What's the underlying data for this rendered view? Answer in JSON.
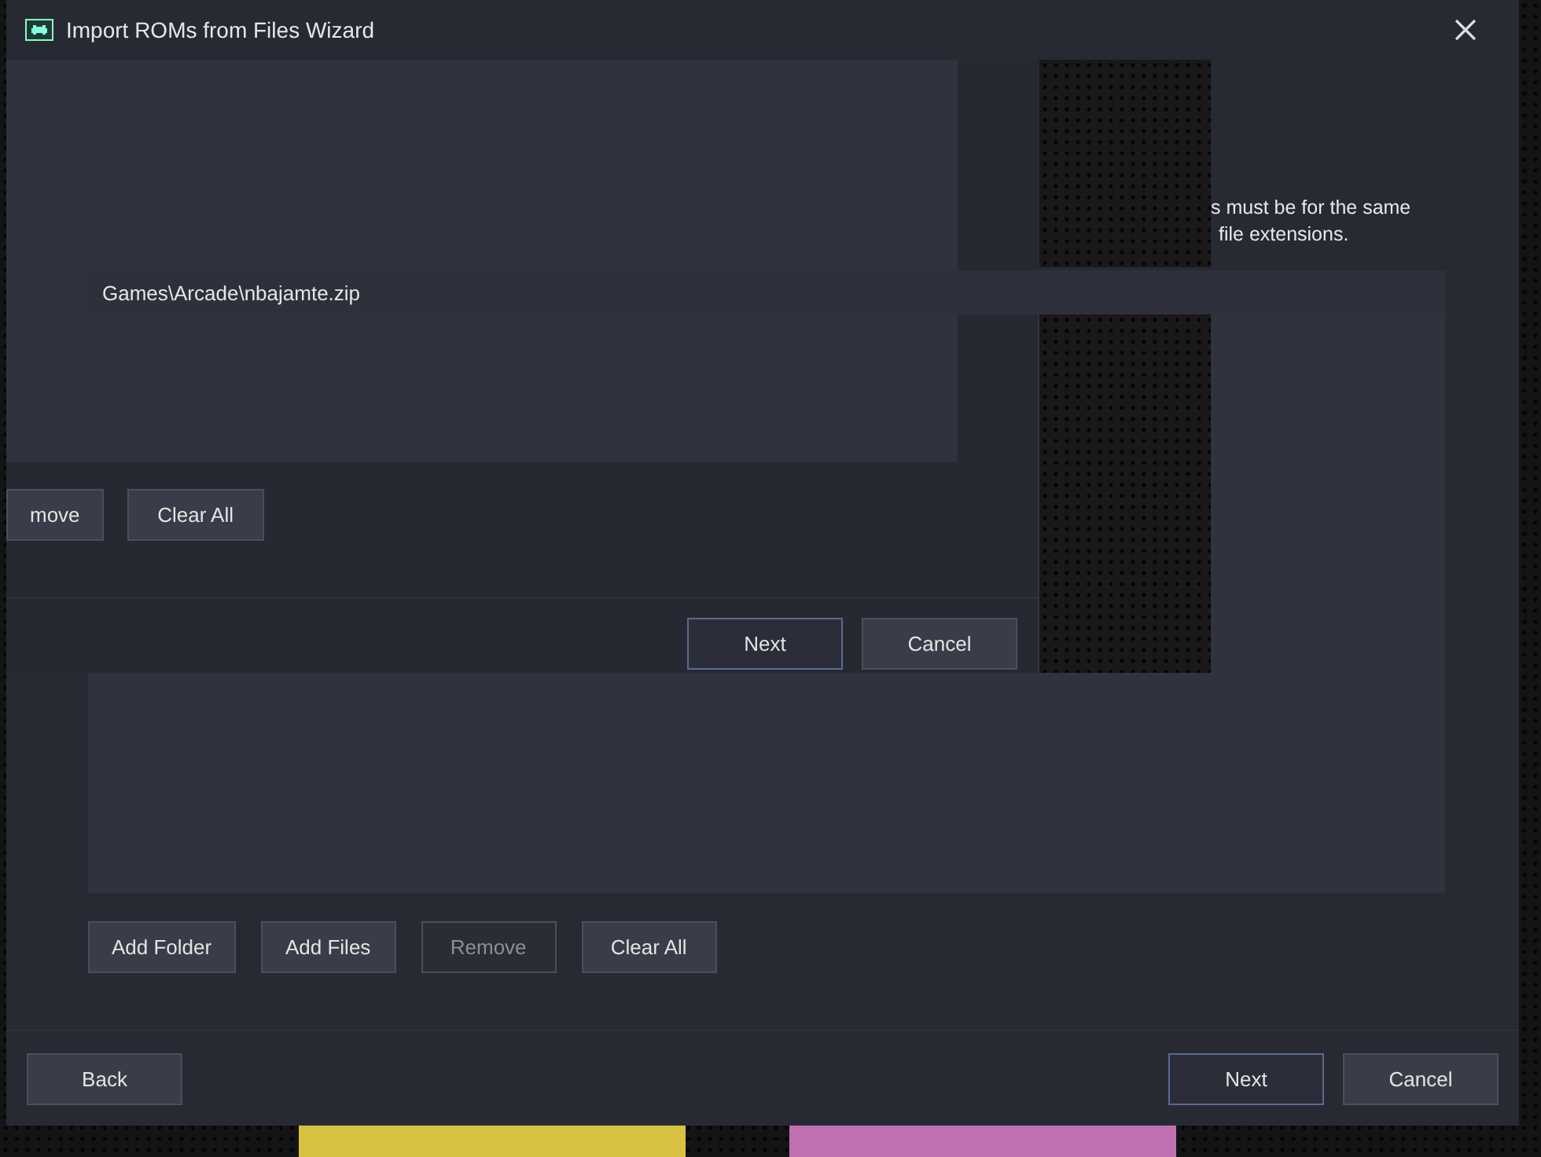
{
  "window": {
    "title": "Import ROMs from Files Wizard"
  },
  "description": [
    "s must be for the same",
    "file extensions."
  ],
  "file_list": {
    "items": [
      {
        "path": "Games\\Arcade\\nbajamte.zip",
        "selected": false
      }
    ]
  },
  "list_buttons": [
    {
      "label": "Add Folder",
      "disabled": false
    },
    {
      "label": "Add Files",
      "disabled": false
    },
    {
      "label": "Remove",
      "disabled": true
    },
    {
      "label": "Clear All",
      "disabled": false
    }
  ],
  "footer": {
    "back": {
      "label": "Back",
      "focused": false
    },
    "next": {
      "label": "Next",
      "focused": true
    },
    "cancel": {
      "label": "Cancel",
      "focused": false
    }
  },
  "ghost": {
    "list_buttons": [
      {
        "label": "move",
        "disabled": false
      },
      {
        "label": "Clear All",
        "disabled": false
      }
    ],
    "footer_buttons": [
      {
        "label": "Next",
        "focused": true
      },
      {
        "label": "Cancel",
        "focused": false
      }
    ]
  }
}
